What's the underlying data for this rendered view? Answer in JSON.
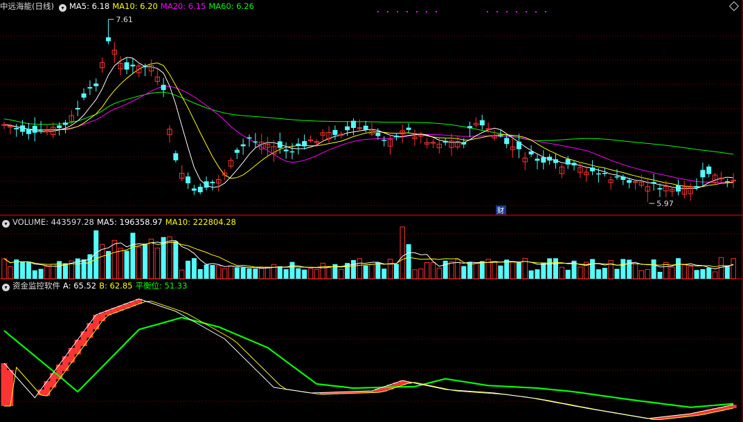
{
  "colors": {
    "up": "#ff3333",
    "down": "#54fcfc",
    "ma5": "#ffffff",
    "ma10": "#ffff00",
    "ma20": "#ff00ff",
    "ma60": "#00ff00",
    "grid": "#8b0000",
    "separator": "#b00000",
    "label": "#dddddd"
  },
  "price_header": {
    "name": "中远海能(日线)",
    "ma5": "MA5: 6.18",
    "ma10": "MA10: 6.20",
    "ma20": "MA20: 6.15",
    "ma60": "MA60: 6.26"
  },
  "volume_header": {
    "volume": "VOLUME: 443597.28",
    "ma5": "MA5: 196358.97",
    "ma10": "MA10: 222804.28"
  },
  "indicator_header": {
    "name": "资金监控软件",
    "a": "A: 65.52",
    "b": "B: 62.85",
    "balance": "平衡位: 51.33"
  },
  "annotations": {
    "high_label": "7.61",
    "low_label": "5.97",
    "marker": "财"
  },
  "chart_data": {
    "type": "candlestick",
    "high": 7.61,
    "low": 5.97,
    "moving_averages": [
      "MA5",
      "MA10",
      "MA20",
      "MA60"
    ],
    "last_values": {
      "MA5": 6.18,
      "MA10": 6.2,
      "MA20": 6.15,
      "MA60": 6.26,
      "VOLUME": 443597.28,
      "VOL_MA5": 196358.97,
      "VOL_MA10": 222804.28,
      "A": 65.52,
      "B": 62.85,
      "balance": 51.33
    }
  }
}
